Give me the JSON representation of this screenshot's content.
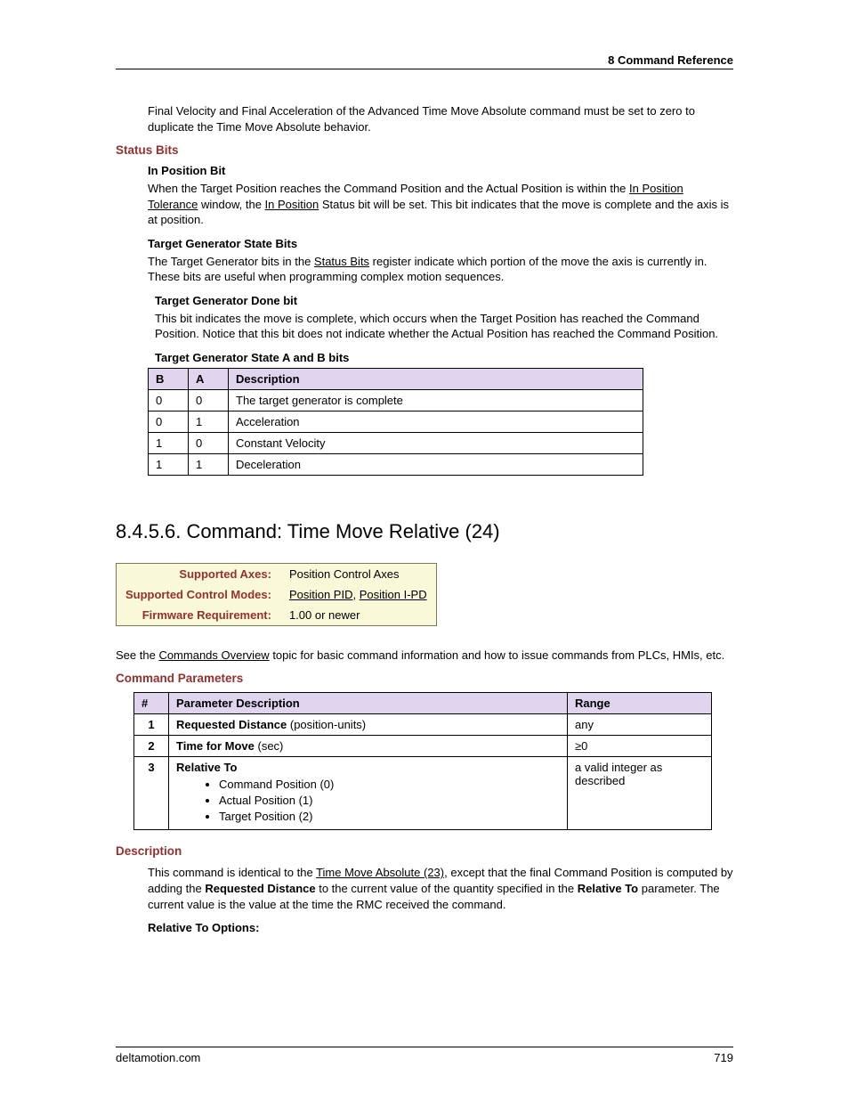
{
  "header": "8  Command Reference",
  "intro": "Final Velocity and Final Acceleration of the Advanced Time Move Absolute command must be set to zero to duplicate the Time Move Absolute behavior.",
  "status_bits_heading": "Status Bits",
  "in_position_bit_heading": "In Position Bit",
  "in_position_bit_text_1": "When the Target Position reaches the Command Position and the Actual Position is within the ",
  "in_position_tolerance_link": "In Position Tolerance",
  "in_position_bit_text_2": " window, the ",
  "in_position_link": "In Position",
  "in_position_bit_text_3": " Status bit will be set. This bit indicates that the move is complete and the axis is at position.",
  "tgs_heading": "Target Generator State Bits",
  "tgs_text_1": "The Target Generator bits in the ",
  "status_bits_link": "Status Bits",
  "tgs_text_2": " register indicate which portion of the move the axis is currently in. These bits are useful when programming complex motion sequences.",
  "tgd_heading": "Target Generator Done bit",
  "tgd_text": "This bit indicates the move is complete, which occurs when the Target Position has reached the Command Position. Notice that this bit does not indicate whether the Actual Position has reached the Command Position.",
  "tgab_heading": "Target Generator State A and B bits",
  "state_table": {
    "headers": {
      "b": "B",
      "a": "A",
      "desc": "Description"
    },
    "rows": [
      {
        "b": "0",
        "a": "0",
        "desc": "The target generator is complete"
      },
      {
        "b": "0",
        "a": "1",
        "desc": "Acceleration"
      },
      {
        "b": "1",
        "a": "0",
        "desc": "Constant Velocity"
      },
      {
        "b": "1",
        "a": "1",
        "desc": "Deceleration"
      }
    ]
  },
  "section_heading": "8.4.5.6. Command: Time Move Relative (24)",
  "info": {
    "axes_label": "Supported Axes:",
    "axes_value": "Position Control Axes",
    "modes_label": "Supported Control Modes:",
    "modes_link_1": "Position PID",
    "modes_sep": ", ",
    "modes_link_2": "Position I-PD",
    "fw_label": "Firmware Requirement:",
    "fw_value": "1.00 or newer"
  },
  "overview_1": "See the ",
  "overview_link": "Commands Overview",
  "overview_2": " topic for basic command information and how to issue commands from PLCs, HMIs, etc.",
  "cmd_params_heading": "Command Parameters",
  "params": {
    "headers": {
      "num": "#",
      "desc": "Parameter Description",
      "range": "Range"
    },
    "rows": [
      {
        "num": "1",
        "name": "Requested Distance",
        "qual": " (position-units)",
        "range": "any"
      },
      {
        "num": "2",
        "name": "Time for Move",
        "qual": " (sec)",
        "range": "≥0"
      },
      {
        "num": "3",
        "name": "Relative To",
        "range": "a valid integer as described",
        "options": [
          "Command Position (0)",
          "Actual Position (1)",
          "Target Position (2)"
        ]
      }
    ]
  },
  "description_heading": "Description",
  "desc_1": "This command is identical to the ",
  "desc_link": "Time Move Absolute (23)",
  "desc_2": ", except that the final Command Position is computed by adding the ",
  "desc_bold_1": "Requested Distance",
  "desc_3": " to the current value of the quantity specified in the ",
  "desc_bold_2": "Relative To",
  "desc_4": " parameter. The current value is the value at the time the RMC received the command.",
  "relative_to_heading": "Relative To Options:",
  "footer_left": "deltamotion.com",
  "footer_right": "719"
}
